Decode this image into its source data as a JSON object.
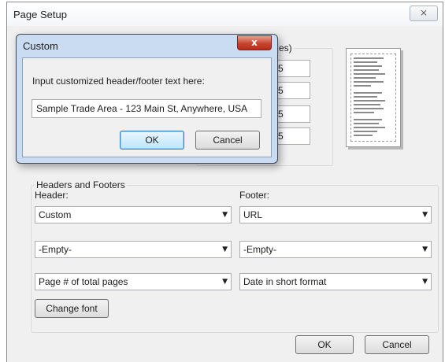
{
  "window": {
    "title": "Page Setup",
    "close_glyph": "⨯"
  },
  "margins": {
    "caption_suffix": "es)",
    "values": [
      "5",
      "5",
      "5",
      "5"
    ]
  },
  "headers_footers": {
    "caption": "Headers and Footers",
    "header_label": "Header:",
    "footer_label": "Footer:",
    "header_rows": [
      "Custom",
      "-Empty-",
      "Page # of total pages"
    ],
    "footer_rows": [
      "URL",
      "-Empty-",
      "Date in short format"
    ],
    "change_font_label": "Change font"
  },
  "footer_buttons": {
    "ok_label": "OK",
    "cancel_label": "Cancel"
  },
  "custom_dialog": {
    "title": "Custom",
    "close_glyph": "x",
    "prompt": "Input customized header/footer text here:",
    "input_value": "Sample Trade Area - 123 Main St, Anywhere, USA",
    "ok_label": "OK",
    "cancel_label": "Cancel"
  },
  "icons": {
    "dropdown": "chevron-down-icon",
    "close": "close-icon",
    "preview": "page-preview-icon"
  }
}
